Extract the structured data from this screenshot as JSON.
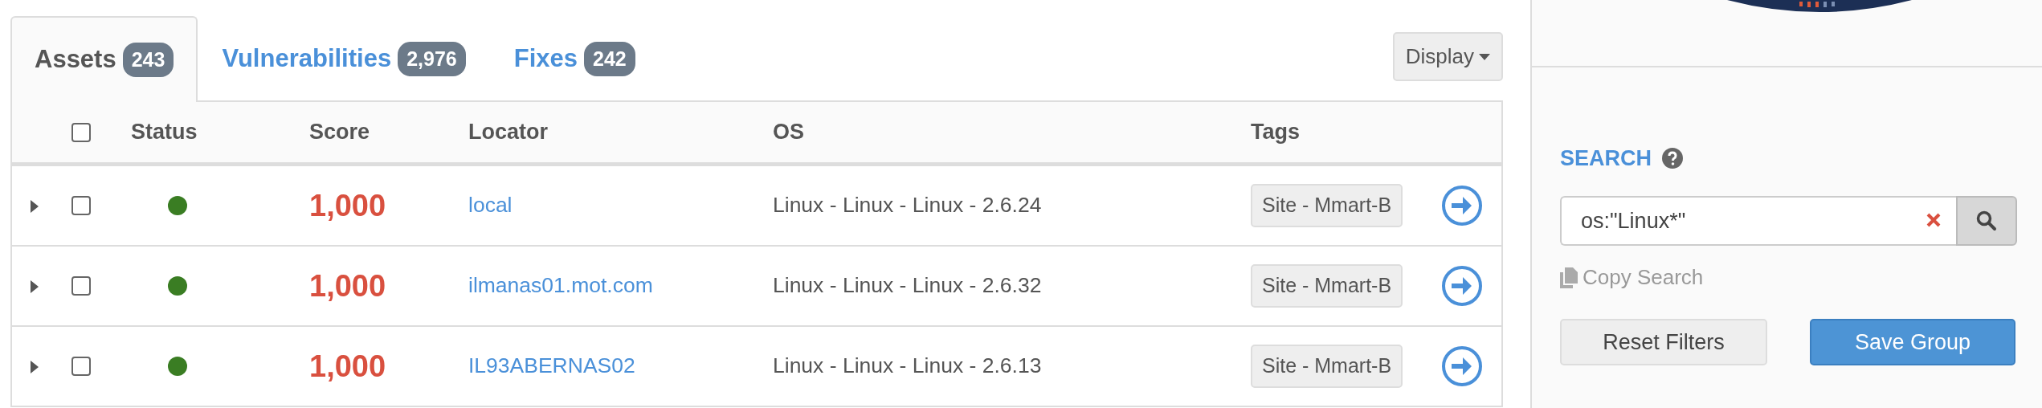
{
  "tabs": [
    {
      "label": "Assets",
      "count": "243",
      "selected": true
    },
    {
      "label": "Vulnerabilities",
      "count": "2,976",
      "selected": false
    },
    {
      "label": "Fixes",
      "count": "242",
      "selected": false
    }
  ],
  "display_button": {
    "label": "Display"
  },
  "table": {
    "columns": [
      "Status",
      "Score",
      "Locator",
      "OS",
      "Tags"
    ],
    "header_checkbox": {
      "checked": false
    },
    "rows": [
      {
        "expanded": false,
        "checked": false,
        "color": "#3a7d23",
        "score": "1,000",
        "locator": "local",
        "os": "Linux - Linux - Linux - 2.6.24",
        "tags": [
          "Site - Mmart-B"
        ]
      },
      {
        "expanded": false,
        "checked": false,
        "color": "#3a7d23",
        "score": "1,000",
        "locator": "ilmanas01.mot.com",
        "os": "Linux - Linux - Linux - 2.6.32",
        "tags": [
          "Site - Mmart-B"
        ]
      },
      {
        "expanded": false,
        "checked": false,
        "color": "#3a7d23",
        "score": "1,000",
        "locator": "IL93ABERNAS02",
        "os": "Linux - Linux - Linux - 2.6.13",
        "tags": [
          "Site - Mmart-B"
        ]
      }
    ]
  },
  "search": {
    "label": "SEARCH",
    "value": "os:\"Linux*\""
  },
  "copy_search": "Copy Search",
  "buttons": [
    {
      "label": "Reset Filters",
      "kind": "default"
    },
    {
      "label": "Save Group",
      "kind": "primary"
    }
  ]
}
